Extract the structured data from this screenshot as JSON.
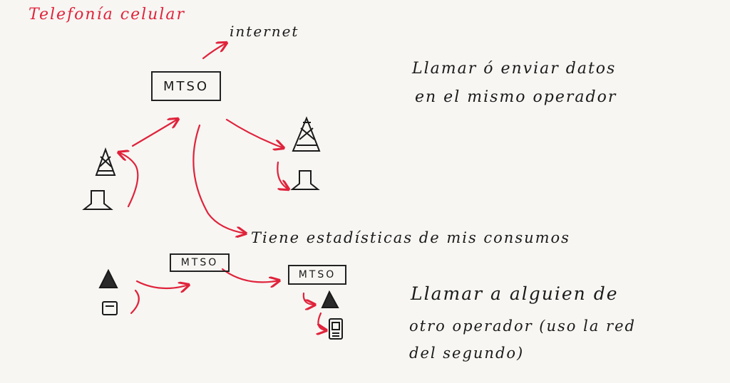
{
  "diagram": {
    "title": "Telefonía celular",
    "internet_label": "internet",
    "mtso_top": "MTSO",
    "note_same_operator": [
      "Llamar ó enviar datos",
      "en el mismo operador"
    ],
    "stats_note": "Tiene estadísticas de mis consumos",
    "mtso_left": "MTSO",
    "mtso_right": "MTSO",
    "note_other_operator": [
      "Llamar a alguien de",
      "otro operador (uso la red",
      "del segundo)"
    ],
    "colors": {
      "ink": "#1a1a1a",
      "accent": "#e0233b",
      "paper": "#f7f6f3"
    },
    "icons": [
      "cell-tower-icon",
      "phone-icon",
      "cell-tower-icon",
      "phone-icon",
      "cell-tower-icon",
      "phone-icon",
      "cell-tower-icon",
      "mobile-phone-icon"
    ]
  }
}
